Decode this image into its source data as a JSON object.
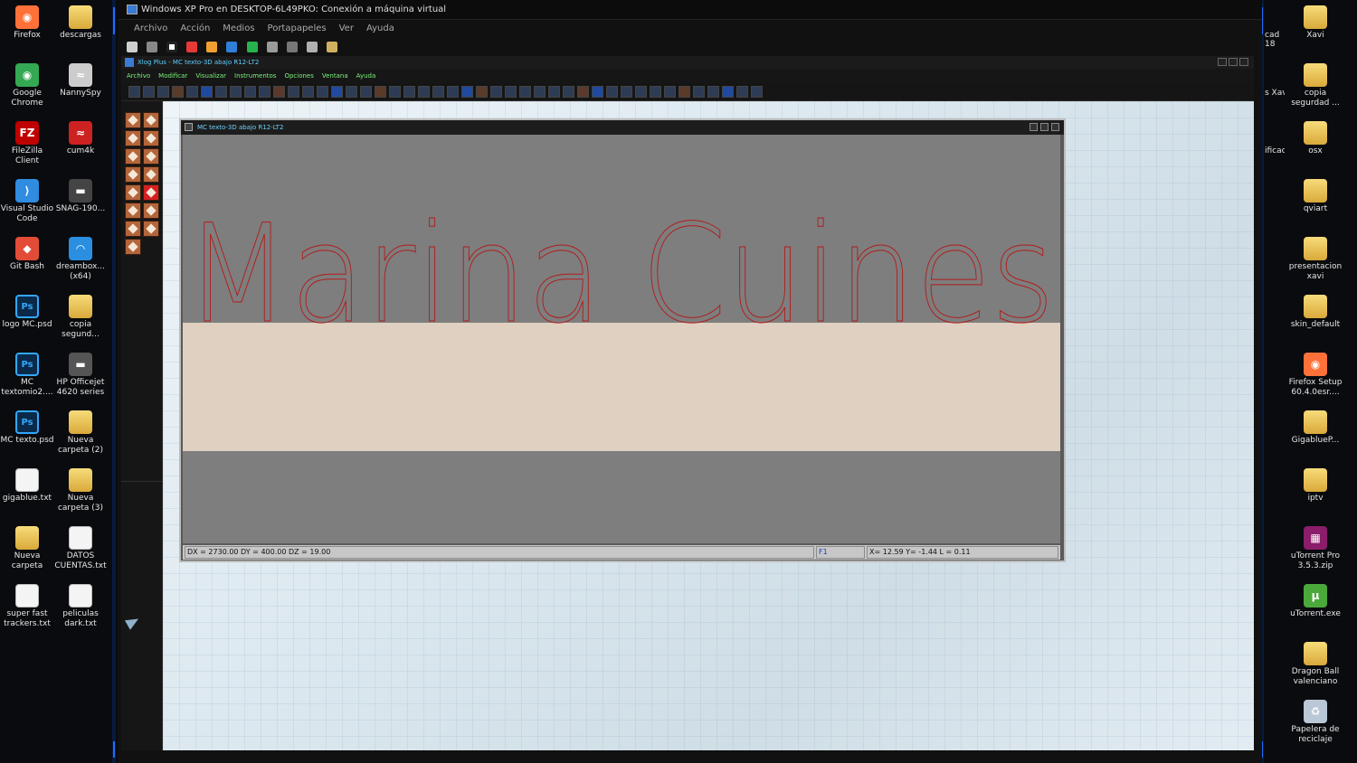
{
  "desktop": {
    "left_icons": [
      {
        "label": "Firefox",
        "icon": "firefox-icon",
        "color": "#ff7139"
      },
      {
        "label": "descargas",
        "icon": "folder-icon",
        "color": "#e6b84a"
      },
      {
        "label": "Google Chrome",
        "icon": "chrome-icon",
        "color": "#34a853"
      },
      {
        "label": "NannySpy",
        "icon": "nannyspy-icon",
        "color": "#cccccc"
      },
      {
        "label": "FileZilla Client",
        "icon": "filezilla-icon",
        "color": "#bf0000"
      },
      {
        "label": "cum4k",
        "icon": "cum4k-icon",
        "color": "#cc2222"
      },
      {
        "label": "Visual Studio Code",
        "icon": "vscode-icon",
        "color": "#2f8cdf"
      },
      {
        "label": "SNAG-190...",
        "icon": "image-file-icon",
        "color": "#444444"
      },
      {
        "label": "Git Bash",
        "icon": "git-bash-icon",
        "color": "#e24c36"
      },
      {
        "label": "dreambox... (x64)",
        "icon": "dreambox-icon",
        "color": "#2a8fe0"
      },
      {
        "label": "logo MC.psd",
        "icon": "photoshop-file-icon",
        "color": "#31a8ff"
      },
      {
        "label": "copia segund...",
        "icon": "folder-icon",
        "color": "#e6b84a"
      },
      {
        "label": "MC textomio2....",
        "icon": "photoshop-file-icon",
        "color": "#31a8ff"
      },
      {
        "label": "HP Officejet 4620 series",
        "icon": "printer-icon",
        "color": "#555555"
      },
      {
        "label": "MC texto.psd",
        "icon": "photoshop-file-icon",
        "color": "#31a8ff"
      },
      {
        "label": "Nueva carpeta (2)",
        "icon": "folder-icon",
        "color": "#e6b84a"
      },
      {
        "label": "gigablue.txt",
        "icon": "text-file-icon",
        "color": "#f4f4f4"
      },
      {
        "label": "Nueva carpeta (3)",
        "icon": "folder-icon",
        "color": "#e6b84a"
      },
      {
        "label": "Nueva carpeta",
        "icon": "folder-icon",
        "color": "#e6b84a"
      },
      {
        "label": "DATOS CUENTAS.txt",
        "icon": "text-file-icon",
        "color": "#f4f4f4"
      },
      {
        "label": "super fast trackers.txt",
        "icon": "text-file-icon",
        "color": "#f4f4f4"
      },
      {
        "label": "peliculas dark.txt",
        "icon": "text-file-icon",
        "color": "#f4f4f4"
      }
    ],
    "right_icons": [
      {
        "label": "Xavi",
        "icon": "folder-icon",
        "color": "#e6b84a"
      },
      {
        "label": "copia segurdad ...",
        "icon": "folder-icon",
        "color": "#e6b84a"
      },
      {
        "label": "osx",
        "icon": "folder-icon",
        "color": "#e6b84a"
      },
      {
        "label": "qviart",
        "icon": "folder-icon",
        "color": "#e6b84a"
      },
      {
        "label": "presentacion xavi",
        "icon": "folder-icon",
        "color": "#e6b84a"
      },
      {
        "label": "skin_default",
        "icon": "folder-icon",
        "color": "#e6b84a"
      },
      {
        "label": "Firefox Setup 60.4.0esr....",
        "icon": "firefox-setup-icon",
        "color": "#ff7139"
      },
      {
        "label": "GigablueP...",
        "icon": "folder-icon",
        "color": "#e6b84a"
      },
      {
        "label": "iptv",
        "icon": "folder-icon",
        "color": "#e6b84a"
      },
      {
        "label": "uTorrent Pro 3.5.3.zip",
        "icon": "winrar-icon",
        "color": "#8b1d6b"
      },
      {
        "label": "uTorrent.exe",
        "icon": "utorrent-icon",
        "color": "#4ba93c"
      },
      {
        "label": "Dragon Ball valenciano",
        "icon": "folder-icon",
        "color": "#e6b84a"
      },
      {
        "label": "Papelera de reciclaje",
        "icon": "recycle-bin-icon",
        "color": "#b9c7d6"
      }
    ],
    "clipped_labels": [
      {
        "label": "cad\n18"
      },
      {
        "label": "s Xavi"
      },
      {
        "label": "ificac..."
      }
    ]
  },
  "vm": {
    "title": "Windows XP Pro en DESKTOP-6L49PKO: Conexión a máquina virtual",
    "menu": [
      "Archivo",
      "Acción",
      "Medios",
      "Portapapeles",
      "Ver",
      "Ayuda"
    ]
  },
  "xlog": {
    "title": "Xlog Plus - MC texto-3D abajo R12-LT2",
    "menu": [
      "Archivo",
      "Modificar",
      "Visualizar",
      "Instrumentos",
      "Opciones",
      "Ventana",
      "Ayuda"
    ],
    "child_title": "MC texto-3D abajo R12-LT2",
    "drawing_text": "Marina Cuines",
    "status": {
      "dims": "DX = 2730.00  DY = 400.00  DZ = 19.00",
      "key": "F1",
      "coords": "X= 12.59    Y= -1.44      L = 0.11"
    },
    "colors": {
      "outline": "#b21b1b",
      "panel": "#dfd0c1",
      "canvas": "#7e7e7e",
      "menu_text": "#7cf27c"
    }
  }
}
